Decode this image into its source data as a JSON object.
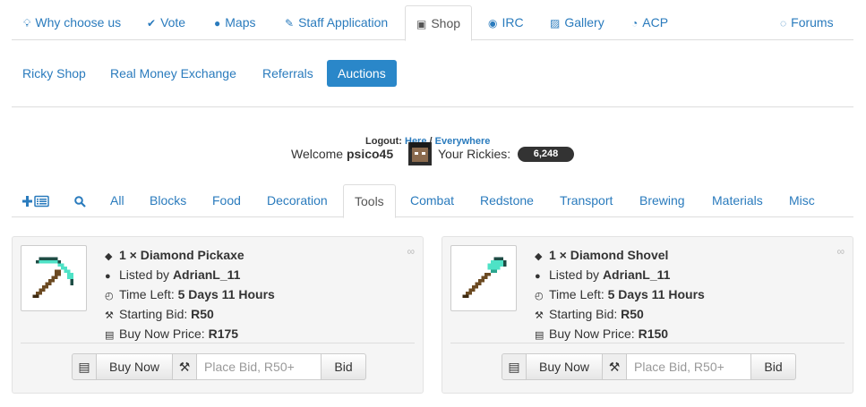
{
  "topnav": [
    {
      "icon": "lightbulb-icon",
      "glyph": "💡",
      "label": "Why choose us"
    },
    {
      "icon": "check-icon",
      "glyph": "✔",
      "label": "Vote"
    },
    {
      "icon": "globe-icon",
      "glyph": "🌐",
      "label": "Maps"
    },
    {
      "icon": "pencil-icon",
      "glyph": "✎",
      "label": "Staff Application"
    },
    {
      "icon": "money-icon",
      "glyph": "💵",
      "label": "Shop"
    },
    {
      "icon": "chat-icon",
      "glyph": "💬",
      "label": "IRC"
    },
    {
      "icon": "picture-icon",
      "glyph": "🖼",
      "label": "Gallery"
    },
    {
      "icon": "dashboard-icon",
      "glyph": "◔",
      "label": "ACP"
    },
    {
      "icon": "comments-icon",
      "glyph": "💬",
      "label": "Forums"
    }
  ],
  "subnav": [
    "Ricky Shop",
    "Real Money Exchange",
    "Referrals",
    "Auctions"
  ],
  "welcome": {
    "logout_label": "Logout:",
    "logout_here": "Here",
    "logout_sep": "/",
    "logout_everywhere": "Everywhere",
    "welcome_label": "Welcome",
    "username": "psico45",
    "rickies_label": "Your Rickies:",
    "rickies_value": "6,248"
  },
  "categories": [
    "All",
    "Blocks",
    "Food",
    "Decoration",
    "Tools",
    "Combat",
    "Redstone",
    "Transport",
    "Brewing",
    "Materials",
    "Misc"
  ],
  "auctions": [
    {
      "item": "1 × Diamond Pickaxe",
      "listed_label": "Listed by",
      "seller": "AdrianL_11",
      "time_label": "Time Left:",
      "time_left": "5 Days 11 Hours",
      "start_label": "Starting Bid:",
      "starting_bid": "R50",
      "buy_label": "Buy Now Price:",
      "buy_price": "R175",
      "buy_button": "Buy Now",
      "bid_placeholder": "Place Bid, R50+",
      "bid_button": "Bid"
    },
    {
      "item": "1 × Diamond Shovel",
      "listed_label": "Listed by",
      "seller": "AdrianL_11",
      "time_label": "Time Left:",
      "time_left": "5 Days 11 Hours",
      "start_label": "Starting Bid:",
      "starting_bid": "R50",
      "buy_label": "Buy Now Price:",
      "buy_price": "R150",
      "buy_button": "Buy Now",
      "bid_placeholder": "Place Bid, R50+",
      "bid_button": "Bid"
    }
  ],
  "colors": {
    "link": "#2a7bbd",
    "active_pill": "#2a87c9",
    "diamond": "#4ee2c6",
    "stick": "#6b4a22"
  }
}
